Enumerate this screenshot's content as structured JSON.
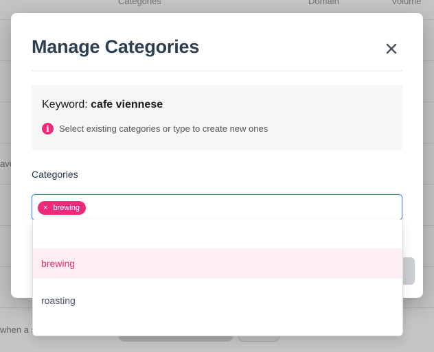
{
  "background": {
    "headers": [
      "Categories",
      "Domain",
      "Volume"
    ],
    "snippets": [
      "ave",
      "when a s"
    ]
  },
  "modal": {
    "title": "Manage Categories",
    "close_label": "×",
    "keyword_prefix": "Keyword:",
    "keyword_value": "cafe viennese",
    "hint": "Select existing categories or type to create new ones",
    "info_glyph": "i",
    "categories_label": "Categories",
    "selected_tags": [
      {
        "label": "brewing",
        "remove": "×"
      }
    ],
    "options": [
      {
        "label": "brewing",
        "selected": true
      },
      {
        "label": "roasting",
        "selected": false
      }
    ]
  },
  "colors": {
    "accent": "#ee2a7b",
    "title": "#2c3e50",
    "focus_border": "#3b82f6",
    "active_option_bg": "#fdeef4"
  }
}
